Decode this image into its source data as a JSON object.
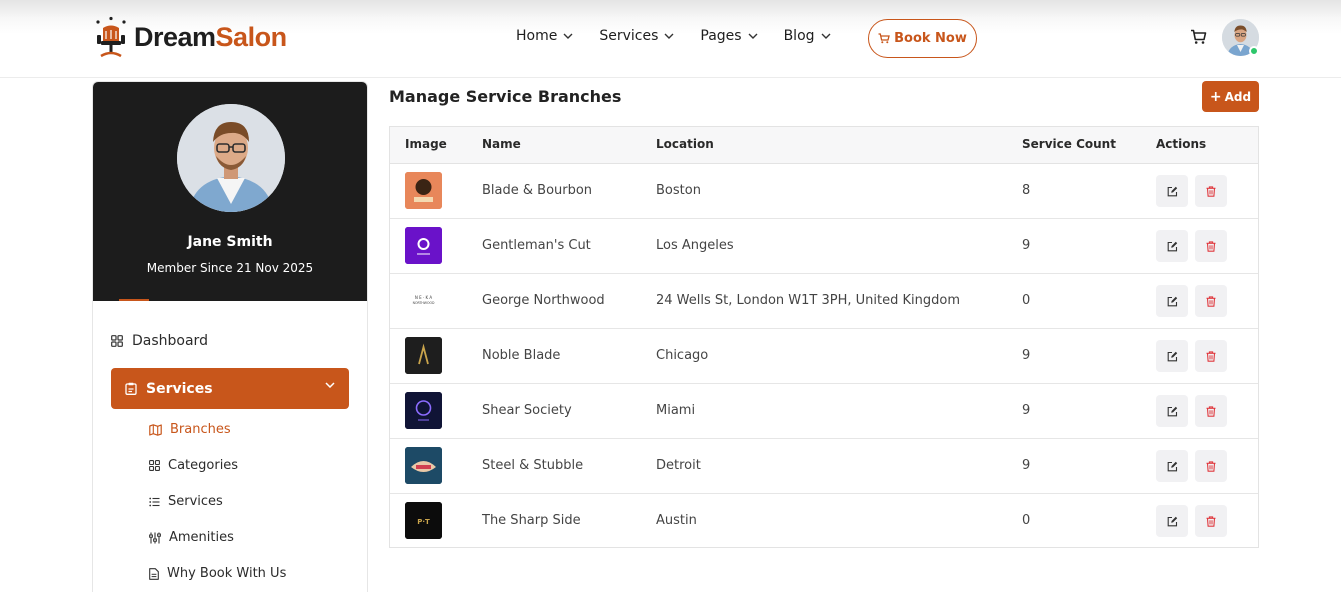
{
  "brand": {
    "part1": "Dream",
    "part2": "Salon",
    "accent": "#c8561b"
  },
  "nav": [
    {
      "label": "Home"
    },
    {
      "label": "Services"
    },
    {
      "label": "Pages"
    },
    {
      "label": "Blog"
    }
  ],
  "header": {
    "book_label": "Book Now"
  },
  "profile": {
    "name": "Jane Smith",
    "member_since": "Member Since 21 Nov 2025"
  },
  "sidebar": {
    "dashboard": "Dashboard",
    "services_group": "Services",
    "sub": [
      {
        "label": "Branches",
        "icon": "map-icon",
        "active": true
      },
      {
        "label": "Categories",
        "icon": "grid-icon"
      },
      {
        "label": "Services",
        "icon": "list-icon"
      },
      {
        "label": "Amenities",
        "icon": "sliders-icon"
      },
      {
        "label": "Why Book With Us",
        "icon": "document-icon"
      }
    ]
  },
  "main": {
    "title": "Manage Service Branches",
    "add_label": "Add",
    "columns": [
      "Image",
      "Name",
      "Location",
      "Service Count",
      "Actions"
    ],
    "rows": [
      {
        "name": "Blade & Bourbon",
        "location": "Boston",
        "count": "8",
        "thumb_color": "#e8875a"
      },
      {
        "name": "Gentleman's Cut",
        "location": "Los Angeles",
        "count": "9",
        "thumb_color": "#6a12c9"
      },
      {
        "name": "George Northwood",
        "location": "24 Wells St, London W1T 3PH, United Kingdom",
        "count": "0",
        "thumb_color": "#ffffff"
      },
      {
        "name": "Noble Blade",
        "location": "Chicago",
        "count": "9",
        "thumb_color": "#1e1e1e"
      },
      {
        "name": "Shear Society",
        "location": "Miami",
        "count": "9",
        "thumb_color": "#101436"
      },
      {
        "name": "Steel & Stubble",
        "location": "Detroit",
        "count": "9",
        "thumb_color": "#1d4a66"
      },
      {
        "name": "The Sharp Side",
        "location": "Austin",
        "count": "0",
        "thumb_color": "#0c0c0c"
      }
    ]
  }
}
